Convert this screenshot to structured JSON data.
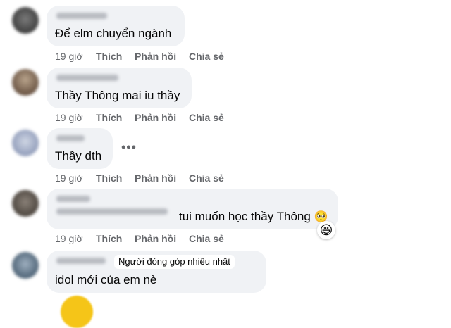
{
  "comments": [
    {
      "text": "Để elm chuyển ngành",
      "actions": {
        "time": "19 giờ",
        "like": "Thích",
        "reply": "Phản hồi",
        "share": "Chia sẻ"
      }
    },
    {
      "text": "Thầy Thông mai iu thầy",
      "actions": {
        "time": "19 giờ",
        "like": "Thích",
        "reply": "Phản hồi",
        "share": "Chia sẻ"
      }
    },
    {
      "text": "Thầy dth",
      "more": "•••",
      "actions": {
        "time": "19 giờ",
        "like": "Thích",
        "reply": "Phản hồi",
        "share": "Chia sẻ"
      }
    },
    {
      "text": "tui muốn học thầy Thông",
      "emoji": "🥺",
      "reaction": "😆",
      "actions": {
        "time": "19 giờ",
        "like": "Thích",
        "reply": "Phản hồi",
        "share": "Chia sẻ"
      }
    },
    {
      "badge": "Người đóng góp nhiều nhất",
      "text": "idol mới của em nè"
    }
  ],
  "colors": {
    "bubble": "#f0f2f5",
    "action_text": "#65676b",
    "comment_text": "#050505"
  }
}
